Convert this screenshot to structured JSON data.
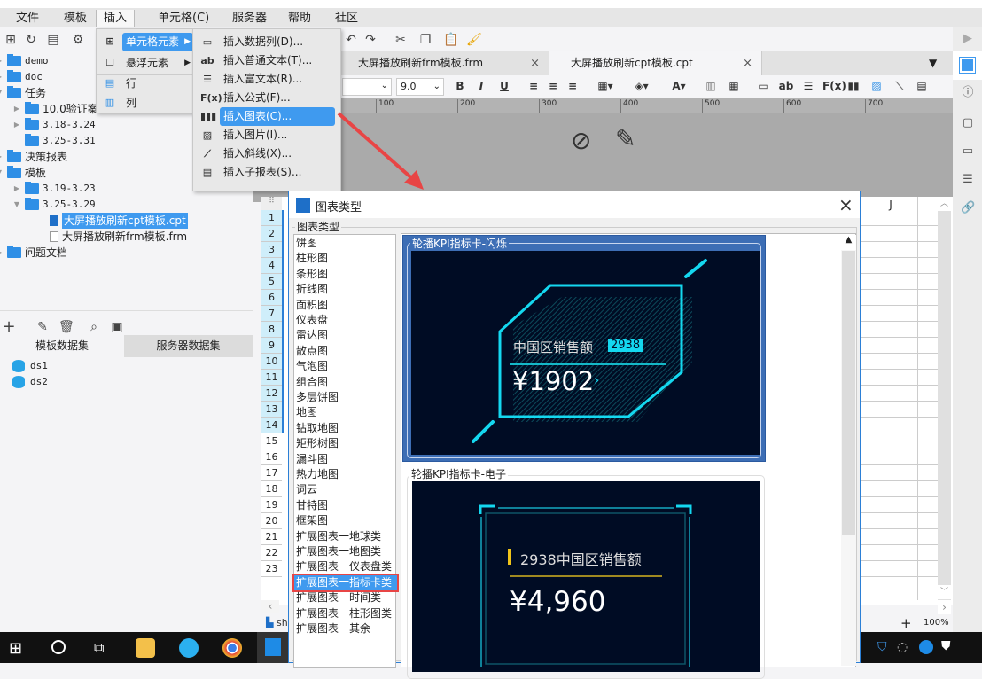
{
  "menubar": {
    "items": [
      "文件",
      "模板",
      "插入",
      "单元格(C)",
      "服务器",
      "帮助",
      "社区"
    ],
    "pressed_index": 2
  },
  "left_panel": {
    "tree": [
      {
        "label": "demo",
        "level": 0,
        "type": "folder",
        "expand": "closed"
      },
      {
        "label": "doc",
        "level": 0,
        "type": "folder",
        "expand": "closed"
      },
      {
        "label": "任务",
        "level": 0,
        "type": "folder",
        "expand": "open"
      },
      {
        "label": "10.0验证案",
        "level": 1,
        "type": "folder",
        "expand": "closed"
      },
      {
        "label": "3.18-3.24",
        "level": 1,
        "type": "folder",
        "expand": "closed"
      },
      {
        "label": "3.25-3.31",
        "level": 1,
        "type": "folder",
        "expand": "none"
      },
      {
        "label": "决策报表",
        "level": 0,
        "type": "folder",
        "expand": "closed"
      },
      {
        "label": "模板",
        "level": 0,
        "type": "folder",
        "expand": "open"
      },
      {
        "label": "3.19-3.23",
        "level": 1,
        "type": "folder",
        "expand": "closed"
      },
      {
        "label": "3.25-3.29",
        "level": 1,
        "type": "folder",
        "expand": "open"
      },
      {
        "label": "大屏播放刷新cpt模板.cpt",
        "level": 2,
        "type": "cpt",
        "selected": true
      },
      {
        "label": "大屏播放刷新frm模板.frm",
        "level": 2,
        "type": "frm"
      },
      {
        "label": "问题文档",
        "level": 0,
        "type": "folder",
        "expand": "closed"
      }
    ],
    "dataset_tabs": [
      "模板数据集",
      "服务器数据集"
    ],
    "datasets": [
      "ds1",
      "ds2"
    ]
  },
  "doc_tabs": [
    {
      "label": "大屏播放刷新frm模板.frm",
      "active": false
    },
    {
      "label": "大屏播放刷新cpt模板.cpt",
      "active": true
    }
  ],
  "format_toolbar": {
    "font_size": "9.0",
    "bold": "B",
    "italic": "I",
    "underline": "U"
  },
  "ruler": [
    "100",
    "200",
    "300",
    "400",
    "500",
    "600",
    "700"
  ],
  "insert_menu": {
    "items": [
      {
        "label": "单元格元素",
        "submenu": true,
        "active": true
      },
      {
        "label": "悬浮元素",
        "submenu": true
      },
      {
        "label": "行"
      },
      {
        "label": "列"
      }
    ],
    "submenu": [
      {
        "icon": "data-column-icon",
        "glyph": "▭",
        "label": "插入数据列(D)..."
      },
      {
        "icon": "text-icon",
        "glyph": "ab",
        "label": "插入普通文本(T)..."
      },
      {
        "icon": "rich-text-icon",
        "glyph": "☰",
        "label": "插入富文本(R)..."
      },
      {
        "icon": "formula-icon",
        "glyph": "F(x)",
        "label": "插入公式(F)..."
      },
      {
        "icon": "chart-icon",
        "glyph": "▮▮▮",
        "label": "插入图表(C)...",
        "active": true
      },
      {
        "icon": "image-icon",
        "glyph": "▨",
        "label": "插入图片(I)..."
      },
      {
        "icon": "slash-line-icon",
        "glyph": "⟋",
        "label": "插入斜线(X)..."
      },
      {
        "icon": "sub-report-icon",
        "glyph": "▤",
        "label": "插入子报表(S)..."
      }
    ]
  },
  "sheet": {
    "rows": [
      "1",
      "2",
      "3",
      "4",
      "5",
      "6",
      "7",
      "8",
      "9",
      "10",
      "11",
      "12",
      "13",
      "14",
      "15",
      "16",
      "17",
      "18",
      "19",
      "20",
      "21",
      "22",
      "23"
    ],
    "highlighted_rows": 14,
    "column_header": "J",
    "sheet_tab": "sh",
    "zoom": "100%",
    "zoom_plus": "+"
  },
  "dialog": {
    "title": "图表类型",
    "group_label": "图表类型",
    "chart_types": [
      "饼图",
      "柱形图",
      "条形图",
      "折线图",
      "面积图",
      "仪表盘",
      "雷达图",
      "散点图",
      "气泡图",
      "组合图",
      "多层饼图",
      "地图",
      "钻取地图",
      "矩形树图",
      "漏斗图",
      "热力地图",
      "词云",
      "甘特图",
      "框架图",
      "扩展图表一地球类",
      "扩展图表一地图类",
      "扩展图表一仪表盘类",
      "扩展图表一指标卡类",
      "扩展图表一时间类",
      "扩展图表一柱形图类",
      "扩展图表一其余"
    ],
    "selected_index": 22,
    "previews": [
      {
        "label": "轮播KPI指标卡-闪烁",
        "selected": true,
        "title": "中国区销售额",
        "badge": "2938",
        "value": "¥1902",
        "arrow": "›"
      },
      {
        "label": "轮播KPI指标卡-电子",
        "selected": false,
        "title": "2938中国区销售额",
        "value": "¥4,960"
      }
    ],
    "close": "×"
  },
  "colors": {
    "accent": "#3f9aef",
    "selected_card": "#3d6eb5",
    "kpi_bg": "#000c24",
    "cyan": "#14d8f0",
    "annotation": "#e84545"
  }
}
